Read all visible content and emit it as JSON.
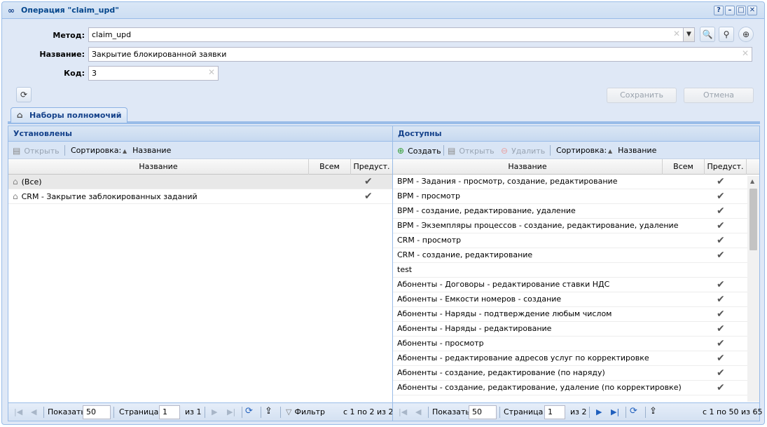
{
  "window": {
    "title": "Операция \"claim_upd\"",
    "tools": [
      "?",
      "–",
      "□",
      "✕"
    ]
  },
  "form": {
    "method_label": "Метод:",
    "method_value": "claim_upd",
    "name_label": "Название:",
    "name_value": "Закрытие блокированной заявки",
    "code_label": "Код:",
    "code_value": "3",
    "save_button": "Сохранить",
    "cancel_button": "Отмена"
  },
  "tabs": [
    {
      "label": "Наборы полномочий",
      "active": true
    }
  ],
  "installed": {
    "title": "Установлены",
    "toolbar": {
      "open": "Открыть",
      "sort_label": "Сортировка:",
      "sort_field": "Название"
    },
    "columns": [
      "Название",
      "Всем",
      "Предуст."
    ],
    "rows": [
      {
        "name": "(Все)",
        "predef": true
      },
      {
        "name": "CRM - Закрытие заблокированных заданий",
        "predef": true
      }
    ],
    "pager": {
      "show_label": "Показать",
      "page_size": "50",
      "page_label": "Страница",
      "page": "1",
      "of": "из 1",
      "filter": "Фильтр",
      "summary": "с 1 по 2 из 2"
    }
  },
  "available": {
    "title": "Доступны",
    "toolbar": {
      "create": "Создать",
      "open": "Открыть",
      "delete": "Удалить",
      "sort_label": "Сортировка:",
      "sort_field": "Название"
    },
    "columns": [
      "Название",
      "Всем",
      "Предуст."
    ],
    "rows": [
      {
        "name": "BPM - Задания - просмотр, создание, редактирование",
        "predef": true
      },
      {
        "name": "BPM - просмотр",
        "predef": true
      },
      {
        "name": "BPM - создание, редактирование, удаление",
        "predef": true
      },
      {
        "name": "BPM - Экземпляры процессов - создание, редактирование, удаление",
        "predef": true
      },
      {
        "name": "CRM - просмотр",
        "predef": true
      },
      {
        "name": "CRM - создание, редактирование",
        "predef": true
      },
      {
        "name": "test",
        "predef": false
      },
      {
        "name": "Абоненты - Договоры - редактирование ставки НДС",
        "predef": true
      },
      {
        "name": "Абоненты - Емкости номеров - создание",
        "predef": true
      },
      {
        "name": "Абоненты - Наряды - подтверждение любым числом",
        "predef": true
      },
      {
        "name": "Абоненты - Наряды - редактирование",
        "predef": true
      },
      {
        "name": "Абоненты - просмотр",
        "predef": true
      },
      {
        "name": "Абоненты - редактирование адресов услуг по корректировке",
        "predef": true
      },
      {
        "name": "Абоненты - создание, редактирование (по наряду)",
        "predef": true
      },
      {
        "name": "Абоненты - создание, редактирование, удаление (по корректировке)",
        "predef": true
      }
    ],
    "pager": {
      "show_label": "Показать",
      "page_size": "50",
      "page_label": "Страница",
      "page": "1",
      "of": "из 2",
      "summary": "с 1 по 50 из 65"
    }
  },
  "icons": {
    "check": "✔",
    "basket": "basket-icon",
    "refresh": "refresh-icon"
  }
}
